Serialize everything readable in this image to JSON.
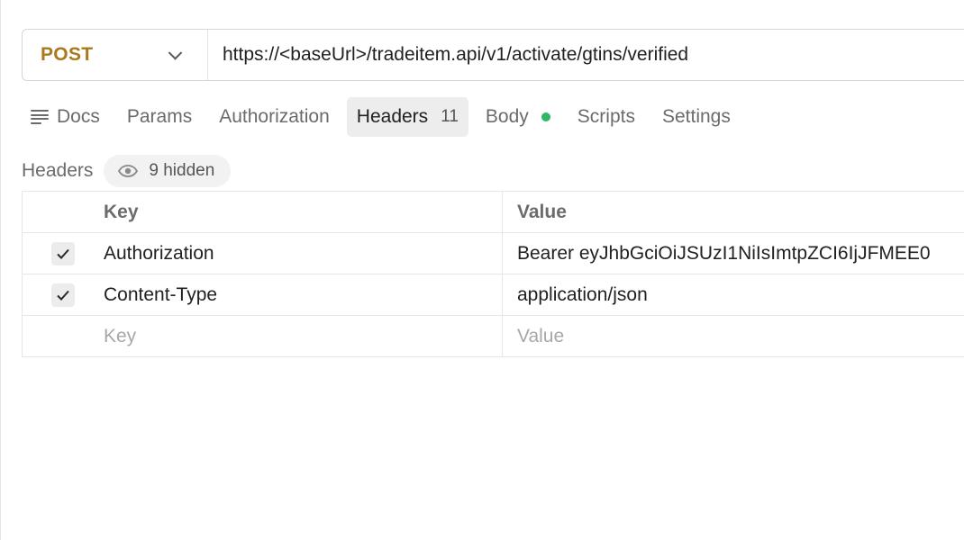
{
  "request": {
    "method": "POST",
    "url": "https://<baseUrl>/tradeitem.api/v1/activate/gtins/verified"
  },
  "tabs": [
    {
      "label": "Docs",
      "icon": "docs-icon"
    },
    {
      "label": "Params"
    },
    {
      "label": "Authorization"
    },
    {
      "label": "Headers",
      "count": "11",
      "active": true
    },
    {
      "label": "Body",
      "indicator_color": "#2fb866"
    },
    {
      "label": "Scripts"
    },
    {
      "label": "Settings"
    }
  ],
  "headers_section": {
    "title": "Headers",
    "hidden_label": "9 hidden",
    "hidden_icon": "eye-icon"
  },
  "table": {
    "columns": [
      "Key",
      "Value"
    ],
    "rows": [
      {
        "checked": true,
        "key": "Authorization",
        "value": "Bearer eyJhbGciOiJSUzI1NiIsImtpZCI6IjJFMEE0"
      },
      {
        "checked": true,
        "key": "Content-Type",
        "value": "application/json"
      }
    ],
    "new_row": {
      "key_placeholder": "Key",
      "value_placeholder": "Value"
    }
  },
  "colors": {
    "method": "#a9791c",
    "active_tab_bg": "#ededed",
    "body_indicator": "#2fb866"
  }
}
